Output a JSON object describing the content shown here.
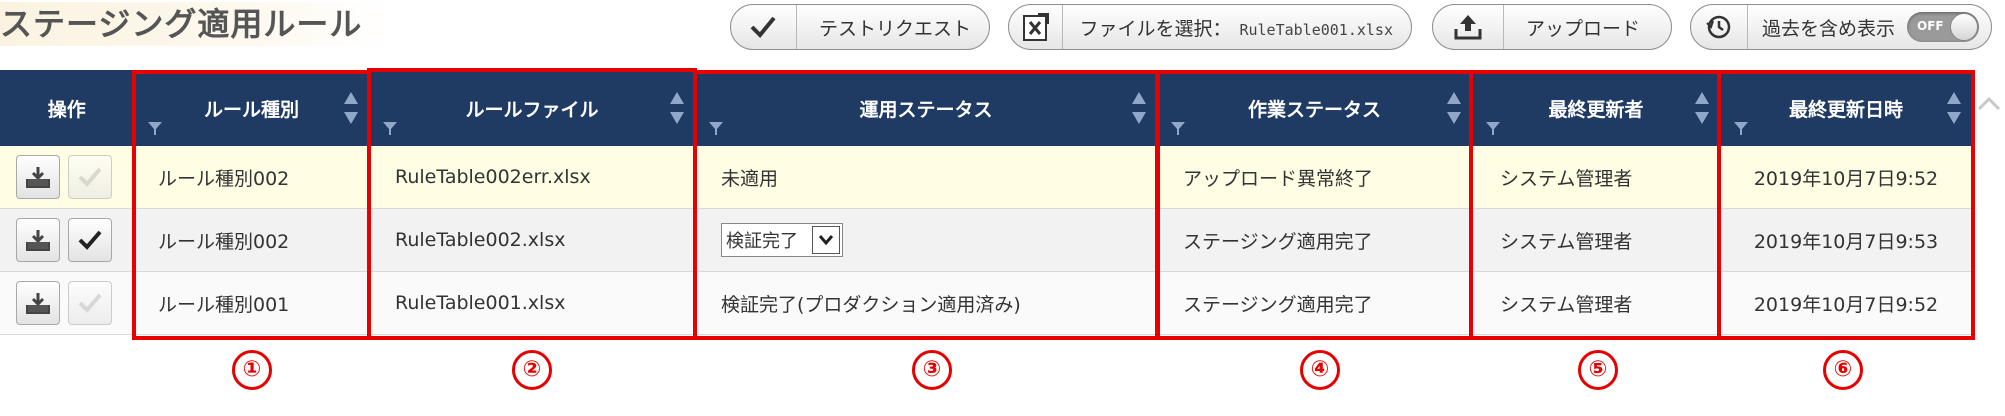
{
  "page_title": "ステージング適用ルール",
  "toolbar": {
    "test_request_label": "テストリクエスト",
    "file_select_label": "ファイルを選択：",
    "file_name": "RuleTable001.xlsx",
    "upload_label": "アップロード",
    "show_past_label": "過去を含め表示",
    "toggle_state": "OFF"
  },
  "table": {
    "headers": [
      "操作",
      "ルール種別",
      "ルールファイル",
      "運用ステータス",
      "作業ステータス",
      "最終更新者",
      "最終更新日時"
    ],
    "rows": [
      {
        "rule_type": "ルール種別002",
        "rule_file": "RuleTable002err.xlsx",
        "op_status": "未適用",
        "work_status": "アップロード異常終了",
        "updater": "システム管理者",
        "updated_at": "2019年10月7日9:52",
        "apply_enabled": false
      },
      {
        "rule_type": "ルール種別002",
        "rule_file": "RuleTable002.xlsx",
        "op_status": "検証完了",
        "work_status": "ステージング適用完了",
        "updater": "システム管理者",
        "updated_at": "2019年10月7日9:53",
        "apply_enabled": true
      },
      {
        "rule_type": "ルール種別001",
        "rule_file": "RuleTable001.xlsx",
        "op_status": "検証完了(プロダクション適用済み)",
        "work_status": "ステージング適用完了",
        "updater": "システム管理者",
        "updated_at": "2019年10月7日9:52",
        "apply_enabled": false
      }
    ]
  },
  "callouts": [
    "①",
    "②",
    "③",
    "④",
    "⑤",
    "⑥"
  ],
  "colors": {
    "header_bg": "#1f3a63",
    "highlight_red": "#e60000",
    "row_highlight": "#fffde3"
  }
}
